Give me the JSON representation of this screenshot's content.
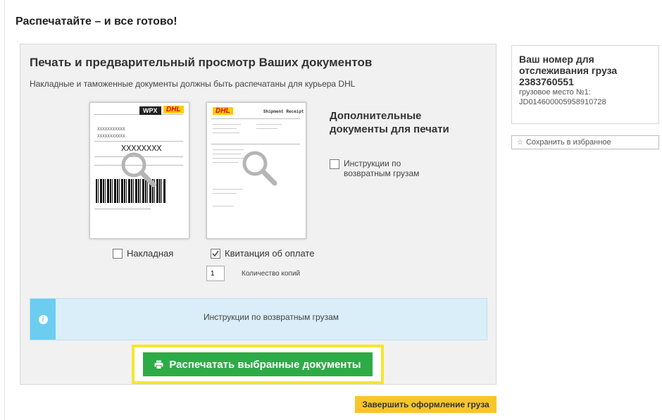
{
  "page": {
    "heading": "Распечатайте – и все готово!"
  },
  "panel": {
    "title": "Печать и предварительный просмотр Ваших документов",
    "subtitle": "Накладные и таможенные документы должны быть распечатаны для курьера DHL"
  },
  "documents": {
    "waybill": {
      "label": "Накладная",
      "checked": false,
      "thumb": {
        "service_badge": "WPX",
        "brand": "DHL",
        "big_code": "XXXXXXXX",
        "line1": "XXXXXXXXXXX",
        "line2": "XXXXXXXXXXX"
      }
    },
    "receipt": {
      "label": "Квитанция об оплате",
      "checked": true,
      "thumb": {
        "brand": "DHL",
        "title": "Shipment Receipt"
      }
    },
    "copies": {
      "value": "1",
      "label": "Количество копий"
    }
  },
  "extra_docs": {
    "title": "Дополнительные документы для печати",
    "return_instructions": {
      "label": "Инструкции по возвратным грузам",
      "checked": false
    }
  },
  "info_bar": {
    "icon": "info-icon",
    "text": "Инструкции по возвратным грузам",
    "accent_color": "#6ccdf0"
  },
  "buttons": {
    "print_selected": "Распечатать выбранные документы",
    "print_icon": "printer-icon",
    "finish": "Завершить оформление груза"
  },
  "tracking": {
    "title": "Ваш номер для отслеживания груза",
    "number": "2383760551",
    "piece_label": "грузовое место №1:",
    "piece_id": "JD014600005958910728"
  },
  "favorites": {
    "icon": "star-icon",
    "label": "Сохранить в избранное"
  },
  "colors": {
    "print_button": "#2eab47",
    "highlight": "#f6e62d",
    "finish_button": "#f8c62b",
    "panel_bg": "#f1f1f1"
  }
}
